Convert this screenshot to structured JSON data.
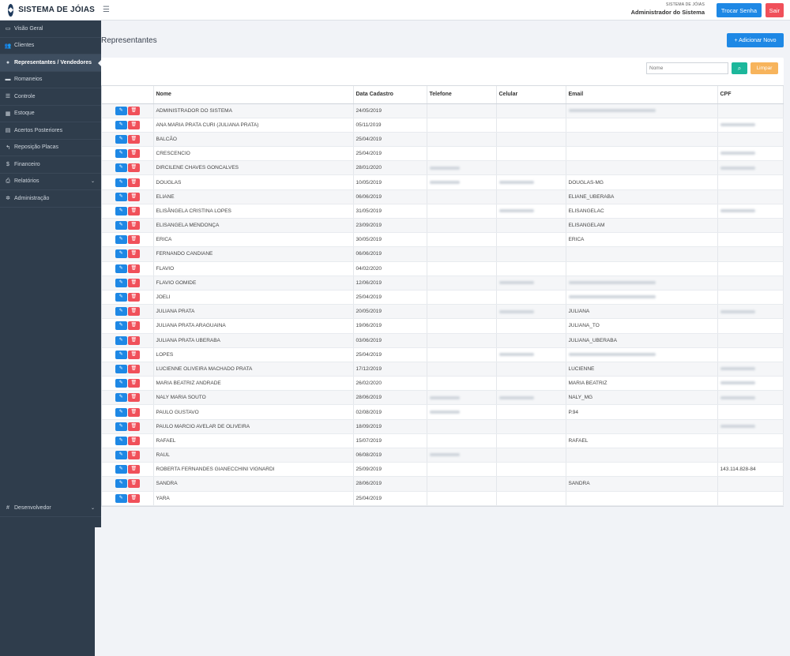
{
  "header": {
    "brand": "SISTEMA DE JÓIAS",
    "system_label": "SISTEMA DE JÓIAS",
    "user_name": "Administrador do Sistema",
    "change_password": "Trocar Senha",
    "exit": "Sair"
  },
  "sidebar": {
    "items": [
      {
        "label": "Visão Geral",
        "icon": "monitor-icon",
        "glyph": "▭"
      },
      {
        "label": "Clientes",
        "icon": "users-icon",
        "glyph": "👥"
      },
      {
        "label": "Representantes / Vendedores",
        "icon": "user-icon",
        "glyph": "●"
      },
      {
        "label": "Romaneios",
        "icon": "box-icon",
        "glyph": "▬"
      },
      {
        "label": "Controle",
        "icon": "list-icon",
        "glyph": "☰"
      },
      {
        "label": "Estoque",
        "icon": "grid-icon",
        "glyph": "▦"
      },
      {
        "label": "Acertos Posteriores",
        "icon": "calendar-icon",
        "glyph": "▤"
      },
      {
        "label": "Reposição Placas",
        "icon": "reply-icon",
        "glyph": "↰"
      },
      {
        "label": "Financeiro",
        "icon": "dollar-icon",
        "glyph": "$"
      },
      {
        "label": "Relatórios",
        "icon": "print-icon",
        "glyph": "⎙"
      },
      {
        "label": "Administração",
        "icon": "gear-icon",
        "glyph": "✲"
      }
    ],
    "developer": "Desenvolvedor"
  },
  "main": {
    "title": "Representantes",
    "add_button": "+ Adicionar Novo",
    "filter": {
      "placeholder": "Nome",
      "clear": "Limpar"
    },
    "columns": [
      "",
      "Nome",
      "Data Cadastro",
      "Telefone",
      "Celular",
      "Email",
      "CPF"
    ],
    "rows": [
      {
        "nome": "ADMINISTRADOR DO SISTEMA",
        "data": "24/05/2019",
        "tel": "",
        "cel": "",
        "email": "",
        "cpf": ""
      },
      {
        "nome": "ANA MARIA PRATA CURI (JULIANA PRATA)",
        "data": "05/11/2019",
        "tel": "",
        "cel": "",
        "email": "",
        "cpf": ""
      },
      {
        "nome": "BALCÃO",
        "data": "25/04/2019",
        "tel": "",
        "cel": "",
        "email": "",
        "cpf": ""
      },
      {
        "nome": "CRESCENCIO",
        "data": "25/04/2019",
        "tel": "",
        "cel": "",
        "email": "",
        "cpf": ""
      },
      {
        "nome": "DIRCILENE CHAVES GONCALVES",
        "data": "28/01/2020",
        "tel": "",
        "cel": "",
        "email": "",
        "cpf": ""
      },
      {
        "nome": "DOUGLAS",
        "data": "10/05/2019",
        "tel": "",
        "cel": "",
        "email": "DOUGLAS-MG",
        "cpf": ""
      },
      {
        "nome": "ELIANE",
        "data": "06/06/2019",
        "tel": "",
        "cel": "",
        "email": "ELIANE_UBERABA",
        "cpf": ""
      },
      {
        "nome": "ELISÂNGELA CRISTINA LOPES",
        "data": "31/05/2019",
        "tel": "",
        "cel": "",
        "email": "ELISANGELAC",
        "cpf": ""
      },
      {
        "nome": "ELISANGELA MENDONÇA",
        "data": "23/09/2019",
        "tel": "",
        "cel": "",
        "email": "ELISANGELAM",
        "cpf": ""
      },
      {
        "nome": "ERICA",
        "data": "30/05/2019",
        "tel": "",
        "cel": "",
        "email": "ERICA",
        "cpf": ""
      },
      {
        "nome": "FERNANDO CANDIANE",
        "data": "06/06/2019",
        "tel": "",
        "cel": "",
        "email": "",
        "cpf": ""
      },
      {
        "nome": "FLAVIO",
        "data": "04/02/2020",
        "tel": "",
        "cel": "",
        "email": "",
        "cpf": ""
      },
      {
        "nome": "FLAVIO GOMIDE",
        "data": "12/06/2019",
        "tel": "",
        "cel": "",
        "email": "",
        "cpf": ""
      },
      {
        "nome": "JOELI",
        "data": "25/04/2019",
        "tel": "",
        "cel": "",
        "email": "",
        "cpf": ""
      },
      {
        "nome": "JULIANA PRATA",
        "data": "20/05/2019",
        "tel": "",
        "cel": "",
        "email": "JULIANA",
        "cpf": ""
      },
      {
        "nome": "JULIANA PRATA ARAGUAINA",
        "data": "19/06/2019",
        "tel": "",
        "cel": "",
        "email": "JULIANA_TO",
        "cpf": ""
      },
      {
        "nome": "JULIANA PRATA UBERABA",
        "data": "03/06/2019",
        "tel": "",
        "cel": "",
        "email": "JULIANA_UBERABA",
        "cpf": ""
      },
      {
        "nome": "LOPES",
        "data": "25/04/2019",
        "tel": "",
        "cel": "",
        "email": "",
        "cpf": ""
      },
      {
        "nome": "LUCIENNE OLIVEIRA MACHADO PRATA",
        "data": "17/12/2019",
        "tel": "",
        "cel": "",
        "email": "LUCIENNE",
        "cpf": ""
      },
      {
        "nome": "MARIA BEATRIZ ANDRADE",
        "data": "26/02/2020",
        "tel": "",
        "cel": "",
        "email": "MARIA BEATRIZ",
        "cpf": ""
      },
      {
        "nome": "NALY MARIA SOUTO",
        "data": "28/06/2019",
        "tel": "",
        "cel": "",
        "email": "NALY_MG",
        "cpf": ""
      },
      {
        "nome": "PAULO GUSTAVO",
        "data": "02/08/2019",
        "tel": "",
        "cel": "",
        "email": "P.94",
        "cpf": ""
      },
      {
        "nome": "PAULO MARCIO AVELAR DE OLIVEIRA",
        "data": "18/09/2019",
        "tel": "",
        "cel": "",
        "email": "",
        "cpf": ""
      },
      {
        "nome": "RAFAEL",
        "data": "15/07/2019",
        "tel": "",
        "cel": "",
        "email": "RAFAEL",
        "cpf": ""
      },
      {
        "nome": "RAUL",
        "data": "06/08/2019",
        "tel": "",
        "cel": "",
        "email": "",
        "cpf": ""
      },
      {
        "nome": "ROBERTA FERNANDES GIANECCHINI VIGNARDI",
        "data": "25/09/2019",
        "tel": "",
        "cel": "",
        "email": "",
        "cpf": "143.114.828-84"
      },
      {
        "nome": "SANDRA",
        "data": "28/06/2019",
        "tel": "",
        "cel": "",
        "email": "SANDRA",
        "cpf": ""
      },
      {
        "nome": "YARA",
        "data": "25/04/2019",
        "tel": "",
        "cel": "",
        "email": "",
        "cpf": ""
      }
    ],
    "redacted": [
      {
        "row": 0,
        "col": "email"
      },
      {
        "row": 1,
        "col": "cpf"
      },
      {
        "row": 3,
        "col": "cpf"
      },
      {
        "row": 4,
        "col": "tel"
      },
      {
        "row": 4,
        "col": "cpf"
      },
      {
        "row": 5,
        "col": "tel"
      },
      {
        "row": 5,
        "col": "cel"
      },
      {
        "row": 7,
        "col": "cel"
      },
      {
        "row": 7,
        "col": "cpf"
      },
      {
        "row": 12,
        "col": "cel"
      },
      {
        "row": 12,
        "col": "email"
      },
      {
        "row": 13,
        "col": "email"
      },
      {
        "row": 14,
        "col": "cel"
      },
      {
        "row": 14,
        "col": "cpf"
      },
      {
        "row": 17,
        "col": "cel"
      },
      {
        "row": 17,
        "col": "email"
      },
      {
        "row": 18,
        "col": "cpf"
      },
      {
        "row": 19,
        "col": "cpf"
      },
      {
        "row": 20,
        "col": "tel"
      },
      {
        "row": 20,
        "col": "cel"
      },
      {
        "row": 20,
        "col": "cpf"
      },
      {
        "row": 21,
        "col": "tel"
      },
      {
        "row": 22,
        "col": "cpf"
      },
      {
        "row": 24,
        "col": "tel"
      }
    ]
  }
}
